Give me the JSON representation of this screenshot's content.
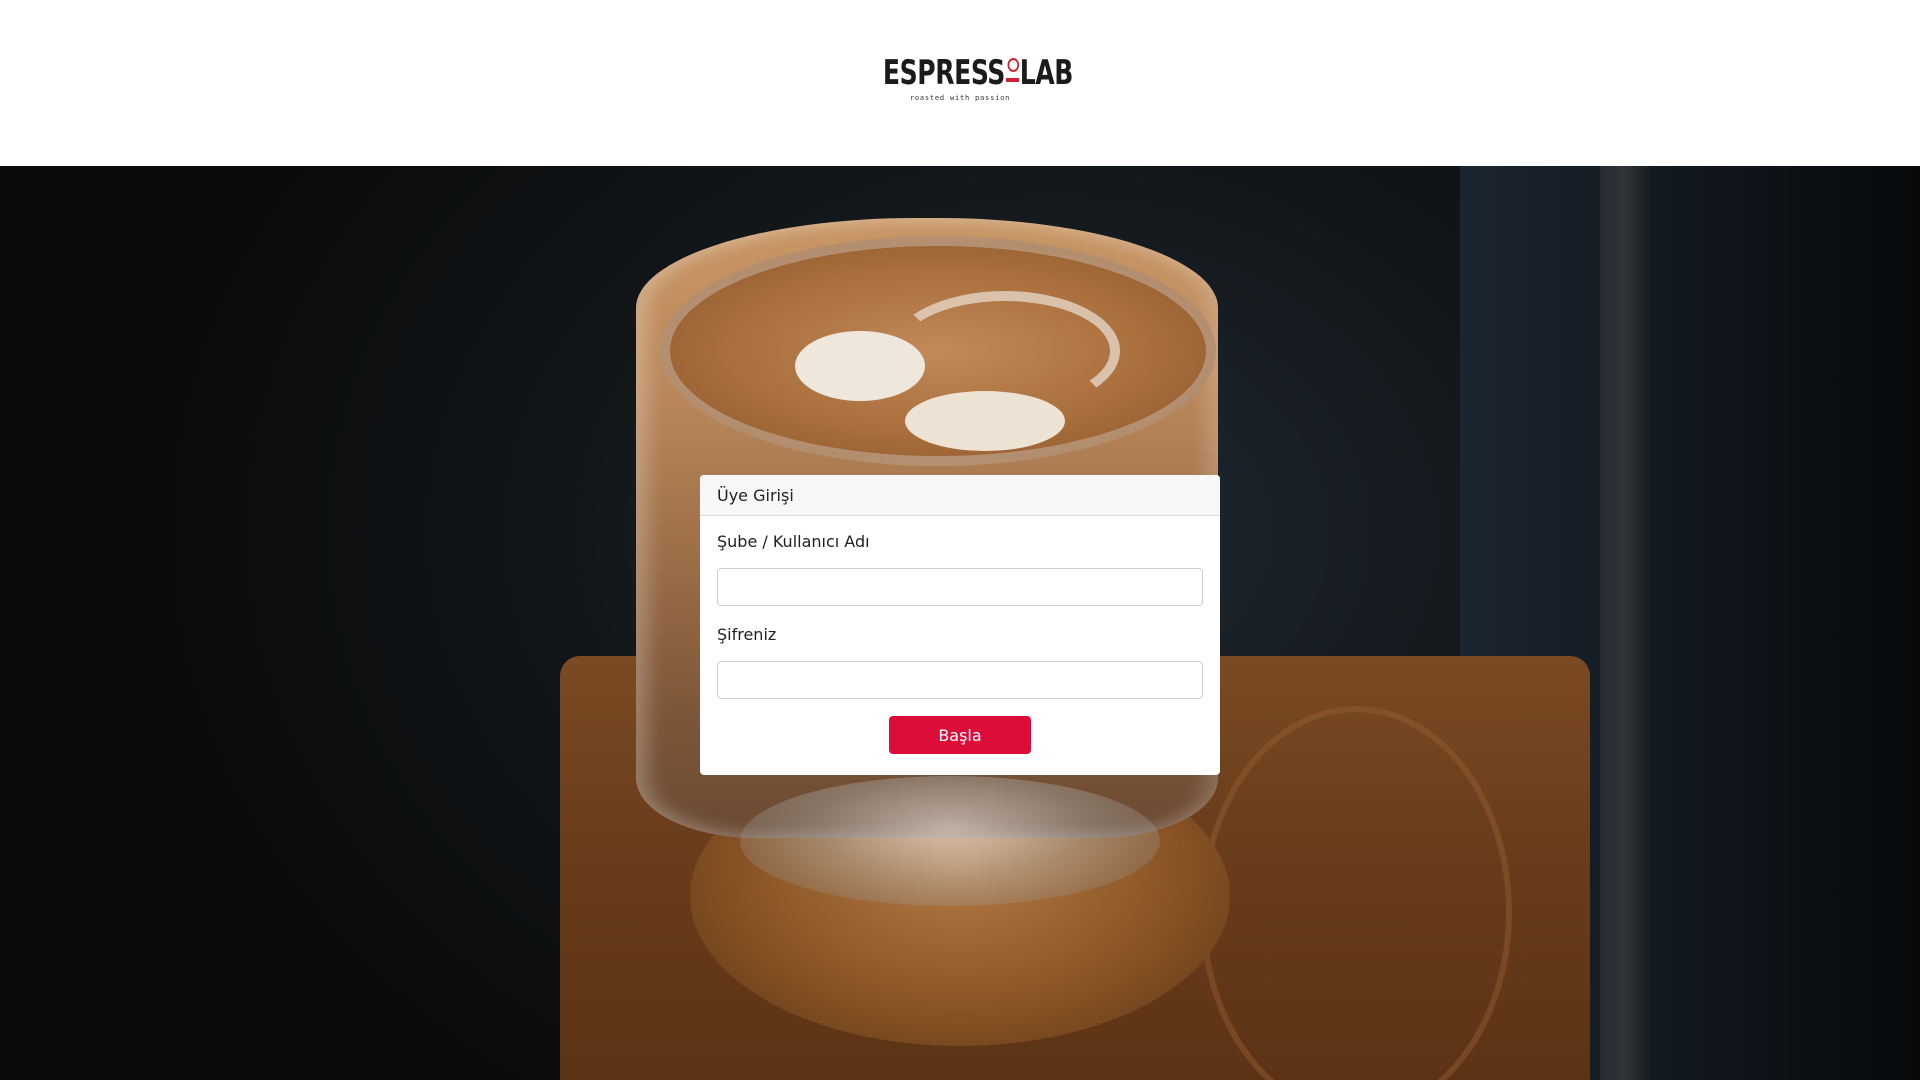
{
  "header": {
    "logo_text_left": "ESPRESS",
    "logo_text_right": "LAB",
    "logo_tagline": "roasted with passion",
    "brand_color": "#d3202f"
  },
  "login": {
    "title": "Üye Girişi",
    "username_label": "Şube / Kullanıcı Adı",
    "username_value": "",
    "password_label": "Şifreniz",
    "password_value": "",
    "submit_label": "Başla",
    "submit_color": "#dd0d3a"
  }
}
